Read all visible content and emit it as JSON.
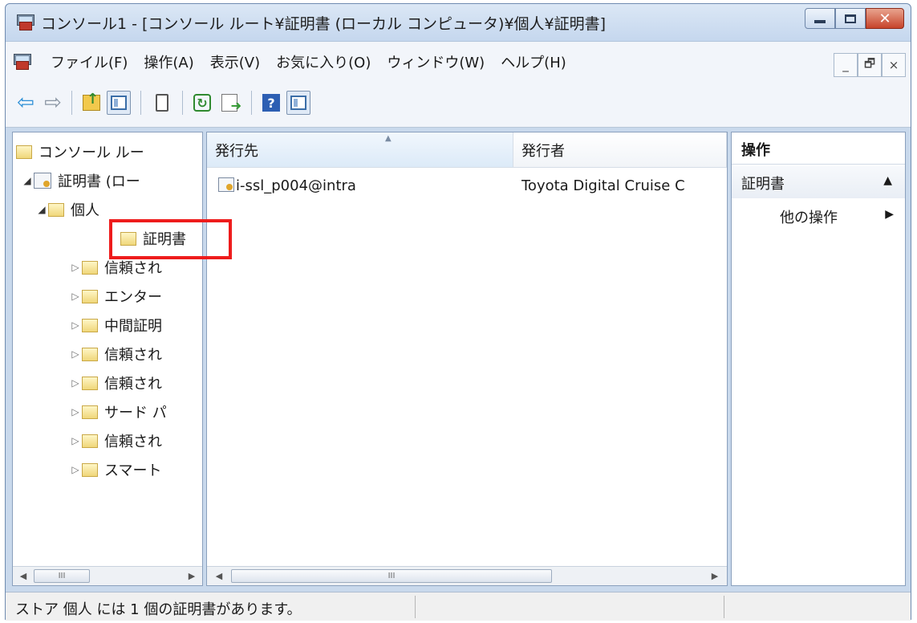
{
  "window": {
    "title": "コンソール1 - [コンソール ルート¥証明書 (ローカル コンピュータ)¥個人¥証明書]",
    "close_glyph": "✕"
  },
  "menu": {
    "items": [
      "ファイル(F)",
      "操作(A)",
      "表示(V)",
      "お気に入り(O)",
      "ウィンドウ(W)",
      "ヘルプ(H)"
    ],
    "mdi_minimize": "_",
    "mdi_restore": "🗗",
    "mdi_close": "×"
  },
  "toolbar": {
    "icons": [
      "back-arrow-icon",
      "forward-arrow-icon",
      "up-folder-icon",
      "show-hide-tree-icon",
      "clipboard-icon",
      "refresh-icon",
      "export-list-icon",
      "help-icon",
      "action-pane-icon"
    ],
    "back": "⇦",
    "forward": "⇨",
    "help": "?",
    "refresh": "↻"
  },
  "tree": {
    "items": [
      {
        "label": "コンソール ルー",
        "expander": "",
        "icon": "folder"
      },
      {
        "label": "証明書 (ロー",
        "expander": "◢",
        "icon": "certificate"
      },
      {
        "label": "個人",
        "expander": "◢",
        "icon": "folder"
      },
      {
        "label": "証明書",
        "expander": "",
        "icon": "folder"
      },
      {
        "label": "信頼され",
        "expander": "▷",
        "icon": "folder"
      },
      {
        "label": "エンター",
        "expander": "▷",
        "icon": "folder"
      },
      {
        "label": "中間証明",
        "expander": "▷",
        "icon": "folder"
      },
      {
        "label": "信頼され",
        "expander": "▷",
        "icon": "folder"
      },
      {
        "label": "信頼され",
        "expander": "▷",
        "icon": "folder"
      },
      {
        "label": "サード パ",
        "expander": "▷",
        "icon": "folder"
      },
      {
        "label": "信頼され",
        "expander": "▷",
        "icon": "folder"
      },
      {
        "label": "スマート",
        "expander": "▷",
        "icon": "folder"
      }
    ],
    "scroll_left": "◀",
    "scroll_right": "▶",
    "thumb_grip": "III"
  },
  "list": {
    "columns": [
      "発行先",
      "発行者"
    ],
    "sort_caret": "▲",
    "rows": [
      {
        "issued_to": "i-ssl_p004@intra",
        "issued_by": "Toyota Digital Cruise C"
      }
    ],
    "scroll_left": "◀",
    "scroll_right": "▶",
    "thumb_grip": "III"
  },
  "actions": {
    "title": "操作",
    "section": "証明書",
    "section_caret": "▲",
    "more": "他の操作",
    "more_caret": "▶"
  },
  "status": {
    "text": "ストア 個人 には 1 個の証明書があります。"
  },
  "colors": {
    "highlight": "#ee1c1c",
    "frame": "#c9d9ec"
  }
}
